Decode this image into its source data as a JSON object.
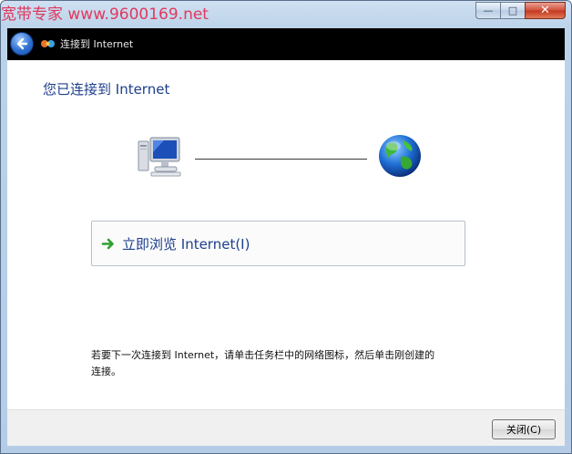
{
  "window": {
    "watermark": "宽带专家 www.9600169.net",
    "buttons": {
      "minimize": "—",
      "maximize": "□",
      "close": "✕"
    }
  },
  "nav": {
    "title": "连接到 Internet"
  },
  "main": {
    "title": "您已连接到 Internet",
    "browse_link": "立即浏览 Internet(I)",
    "hint": "若要下一次连接到 Internet，请单击任务栏中的网络图标，然后单击刚创建的连接。"
  },
  "footer": {
    "close_label": "关闭(C)"
  },
  "icons": {
    "back": "back-arrow-icon",
    "app": "network-connection-icon",
    "computer": "computer-icon",
    "globe": "globe-icon",
    "link": "green-arrow-icon"
  },
  "colors": {
    "accent": "#1e3f8c",
    "watermark": "#e0385f",
    "navbar": "#000000"
  }
}
